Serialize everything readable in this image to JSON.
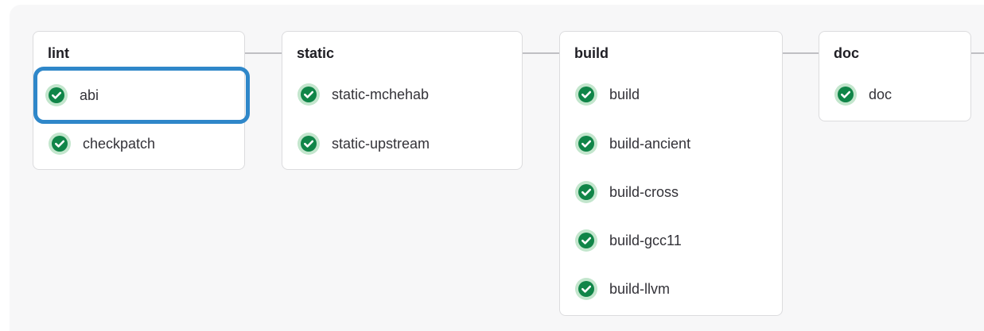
{
  "pipeline": {
    "stages": [
      {
        "title": "lint",
        "jobs": [
          {
            "label": "abi",
            "status": "passed"
          },
          {
            "label": "checkpatch",
            "status": "passed"
          }
        ]
      },
      {
        "title": "static",
        "jobs": [
          {
            "label": "static-mchehab",
            "status": "passed"
          },
          {
            "label": "static-upstream",
            "status": "passed"
          }
        ]
      },
      {
        "title": "build",
        "jobs": [
          {
            "label": "build",
            "status": "passed"
          },
          {
            "label": "build-ancient",
            "status": "passed"
          },
          {
            "label": "build-cross",
            "status": "passed"
          },
          {
            "label": "build-gcc11",
            "status": "passed"
          },
          {
            "label": "build-llvm",
            "status": "passed"
          }
        ]
      },
      {
        "title": "doc",
        "jobs": [
          {
            "label": "doc",
            "status": "passed"
          }
        ]
      }
    ]
  },
  "colors": {
    "success_fill": "#108548",
    "success_ring": "#c3e6cd",
    "highlight_border": "#2f87c9",
    "connector": "#bfbfc3"
  },
  "icons": {
    "job_status": "status-success-icon"
  }
}
